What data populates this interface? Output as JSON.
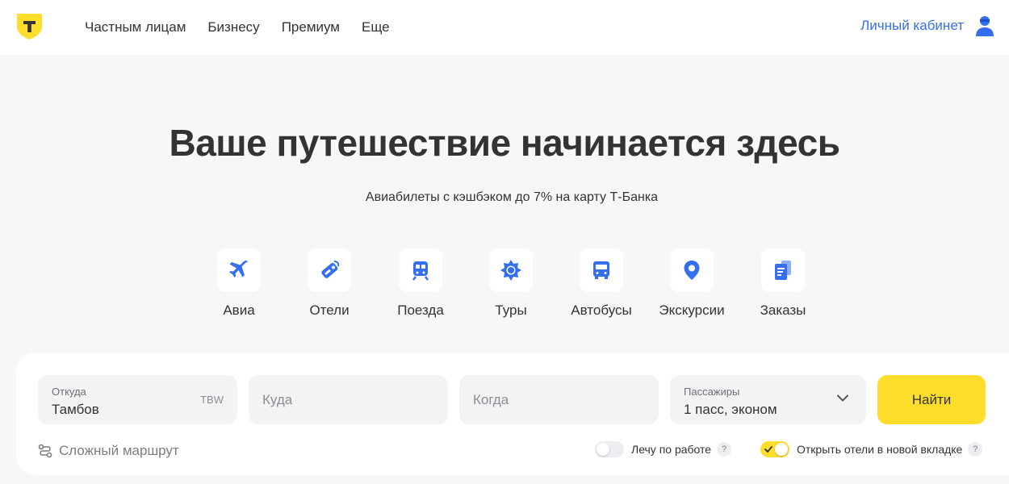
{
  "colors": {
    "brand_yellow": "#ffdd2d",
    "link_blue": "#336fee",
    "icon_blue": "#336fee",
    "background": "#f6f7f8"
  },
  "header": {
    "logo_icon": "t-bank-shield-icon",
    "nav": [
      {
        "label": "Частным лицам"
      },
      {
        "label": "Бизнесу"
      },
      {
        "label": "Премиум"
      },
      {
        "label": "Еще"
      }
    ],
    "cabinet_label": "Личный кабинет",
    "user_icon": "user-avatar-icon"
  },
  "hero": {
    "title": "Ваше путешествие начинается здесь",
    "subtitle": "Авиабилеты с кэшбэком до 7% на карту Т-Банка"
  },
  "categories": [
    {
      "label": "Авиа",
      "icon": "airplane-icon"
    },
    {
      "label": "Отели",
      "icon": "hotel-tag-icon"
    },
    {
      "label": "Поезда",
      "icon": "train-icon"
    },
    {
      "label": "Туры",
      "icon": "sun-icon"
    },
    {
      "label": "Автобусы",
      "icon": "bus-icon"
    },
    {
      "label": "Экскурсии",
      "icon": "map-pin-icon"
    },
    {
      "label": "Заказы",
      "icon": "tickets-icon"
    }
  ],
  "search": {
    "from": {
      "label": "Откуда",
      "value": "Тамбов",
      "code": "TBW"
    },
    "to": {
      "placeholder": "Куда"
    },
    "date": {
      "placeholder": "Когда"
    },
    "passengers": {
      "label": "Пассажиры",
      "value": "1 пасс, эконом"
    },
    "submit_label": "Найти",
    "complex_route_label": "Сложный маршрут",
    "business_trip": {
      "label": "Лечу по работе",
      "enabled": false,
      "help": "?"
    },
    "open_hotels": {
      "label": "Открыть отели в новой вкладке",
      "enabled": true,
      "help": "?"
    }
  }
}
